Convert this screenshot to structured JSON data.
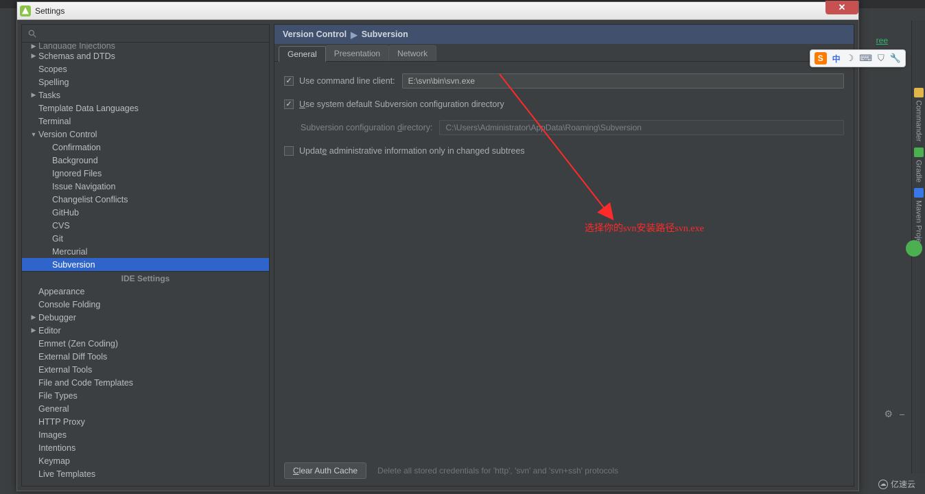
{
  "window": {
    "title": "Settings"
  },
  "breadcrumb": {
    "a": "Version Control",
    "b": "Subversion"
  },
  "tabs": {
    "general": "General",
    "presentation": "Presentation",
    "network": "Network"
  },
  "form": {
    "use_cli_label": "Use command line client:",
    "use_cli_value": "E:\\svn\\bin\\svn.exe",
    "use_sys_dir_label_pre": "U",
    "use_sys_dir_label_post": "se system default Subversion configuration directory",
    "cfg_dir_label_pre": "Subversion configuration ",
    "cfg_dir_label_u": "d",
    "cfg_dir_label_post": "irectory:",
    "cfg_dir_value": "C:\\Users\\Administrator\\AppData\\Roaming\\Subversion",
    "update_admin_label_pre": "Updat",
    "update_admin_label_u": "e",
    "update_admin_label_post": " administrative information only in changed subtrees",
    "clear_cache": "Clear Auth Cache",
    "clear_hint": "Delete all stored credentials for 'http', 'svn' and 'svn+ssh' protocols"
  },
  "annotation": "选择你的svn安装路径svn.exe",
  "ide_header": "IDE Settings",
  "tree": [
    {
      "l": "Language Injections",
      "d": 0,
      "tw": "▶"
    },
    {
      "l": "Schemas and DTDs",
      "d": 0,
      "tw": "▶"
    },
    {
      "l": "Scopes",
      "d": 0,
      "tw": ""
    },
    {
      "l": "Spelling",
      "d": 0,
      "tw": ""
    },
    {
      "l": "Tasks",
      "d": 0,
      "tw": "▶"
    },
    {
      "l": "Template Data Languages",
      "d": 0,
      "tw": ""
    },
    {
      "l": "Terminal",
      "d": 0,
      "tw": ""
    },
    {
      "l": "Version Control",
      "d": 0,
      "tw": "▼"
    },
    {
      "l": "Confirmation",
      "d": 1,
      "tw": ""
    },
    {
      "l": "Background",
      "d": 1,
      "tw": ""
    },
    {
      "l": "Ignored Files",
      "d": 1,
      "tw": ""
    },
    {
      "l": "Issue Navigation",
      "d": 1,
      "tw": ""
    },
    {
      "l": "Changelist Conflicts",
      "d": 1,
      "tw": ""
    },
    {
      "l": "GitHub",
      "d": 1,
      "tw": ""
    },
    {
      "l": "CVS",
      "d": 1,
      "tw": ""
    },
    {
      "l": "Git",
      "d": 1,
      "tw": ""
    },
    {
      "l": "Mercurial",
      "d": 1,
      "tw": ""
    },
    {
      "l": "Subversion",
      "d": 1,
      "tw": "",
      "sel": true
    }
  ],
  "tree_ide": [
    {
      "l": "Appearance",
      "d": 0,
      "tw": ""
    },
    {
      "l": "Console Folding",
      "d": 0,
      "tw": ""
    },
    {
      "l": "Debugger",
      "d": 0,
      "tw": "▶"
    },
    {
      "l": "Editor",
      "d": 0,
      "tw": "▶"
    },
    {
      "l": "Emmet (Zen Coding)",
      "d": 0,
      "tw": ""
    },
    {
      "l": "External Diff Tools",
      "d": 0,
      "tw": ""
    },
    {
      "l": "External Tools",
      "d": 0,
      "tw": ""
    },
    {
      "l": "File and Code Templates",
      "d": 0,
      "tw": ""
    },
    {
      "l": "File Types",
      "d": 0,
      "tw": ""
    },
    {
      "l": "General",
      "d": 0,
      "tw": ""
    },
    {
      "l": "HTTP Proxy",
      "d": 0,
      "tw": ""
    },
    {
      "l": "Images",
      "d": 0,
      "tw": ""
    },
    {
      "l": "Intentions",
      "d": 0,
      "tw": ""
    },
    {
      "l": "Keymap",
      "d": 0,
      "tw": ""
    },
    {
      "l": "Live Templates",
      "d": 0,
      "tw": ""
    }
  ],
  "ime": {
    "cn": "中",
    "items": [
      "☽",
      "⌨",
      "👤",
      "✎"
    ]
  },
  "right_sidebar": [
    {
      "icon": "#e0b64a",
      "label": "Commander"
    },
    {
      "icon": "#4caf50",
      "label": "Gradle"
    },
    {
      "icon": "#3b78e7",
      "label": "Maven Projects"
    }
  ],
  "bg": {
    "tree_link": "ree"
  },
  "watermark": "亿速云"
}
